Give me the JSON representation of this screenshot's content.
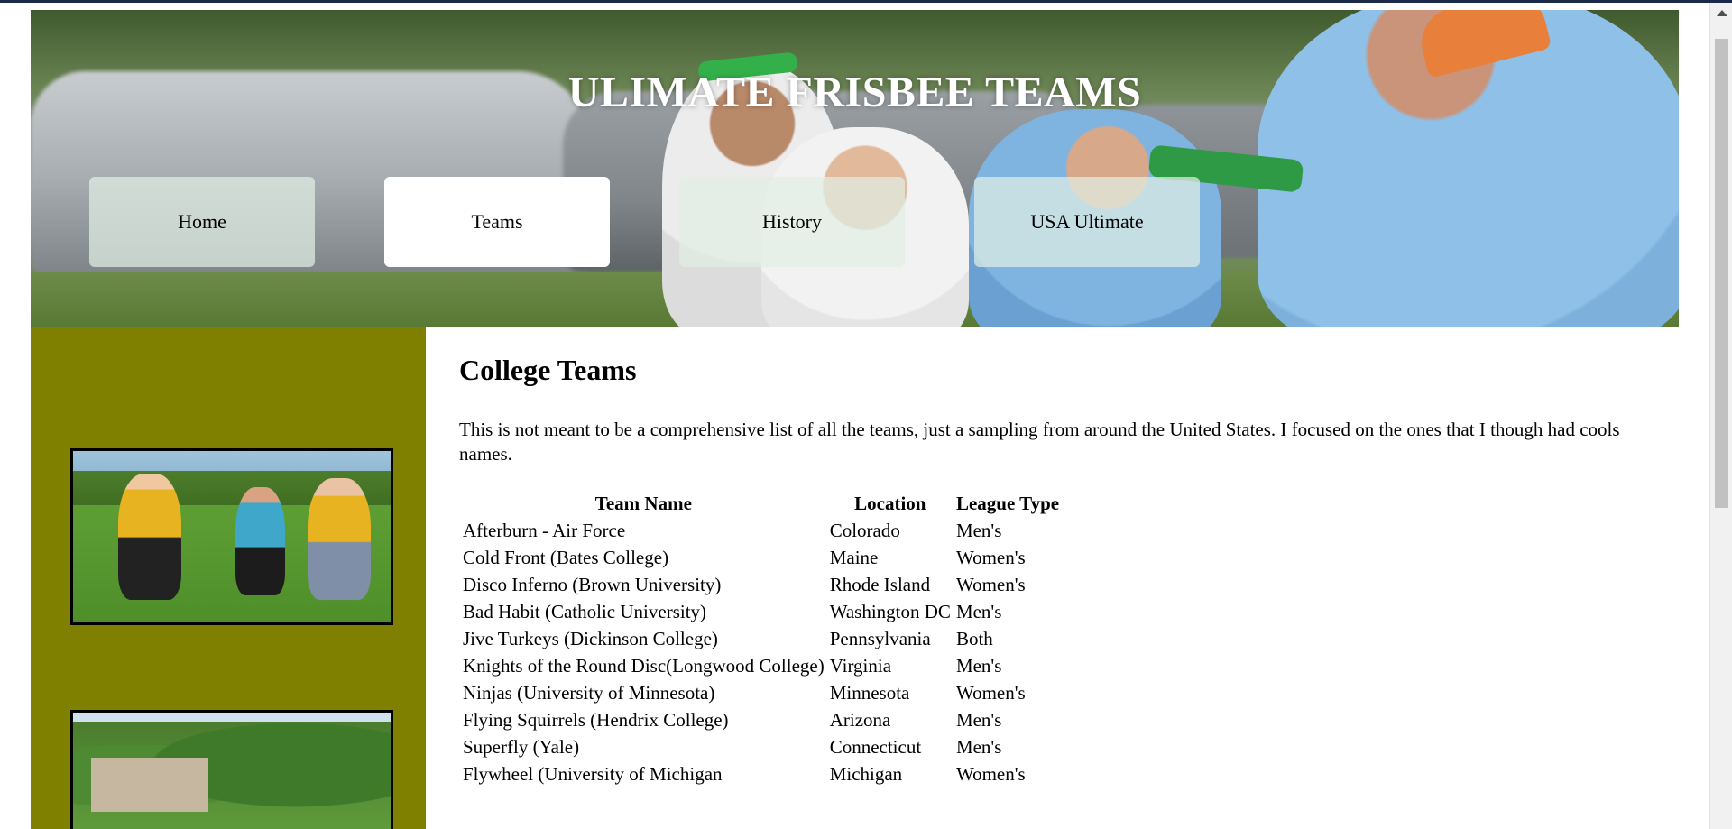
{
  "header": {
    "title": "ULIMATE FRISBEE TEAMS"
  },
  "nav": {
    "items": [
      {
        "label": "Home",
        "active": false
      },
      {
        "label": "Teams",
        "active": true
      },
      {
        "label": "History",
        "active": false
      },
      {
        "label": "USA Ultimate",
        "active": false
      }
    ]
  },
  "main": {
    "heading": "College Teams",
    "intro": "This is not meant to be a comprehensive list of all the teams, just a sampling from around the United States. I focused on the ones that I though had cools names.",
    "table": {
      "headers": [
        "Team Name",
        "Location",
        "League Type"
      ],
      "rows": [
        [
          "Afterburn - Air Force",
          "Colorado",
          "Men's"
        ],
        [
          "Cold Front (Bates College)",
          "Maine",
          "Women's"
        ],
        [
          "Disco Inferno (Brown University)",
          "Rhode Island",
          "Women's"
        ],
        [
          "Bad Habit (Catholic University)",
          "Washington DC",
          "Men's"
        ],
        [
          "Jive Turkeys (Dickinson College)",
          "Pennsylvania",
          "Both"
        ],
        [
          "Knights of the Round Disc(Longwood College)",
          "Virginia",
          "Men's"
        ],
        [
          "Ninjas (University of Minnesota)",
          "Minnesota",
          "Women's"
        ],
        [
          "Flying Squirrels (Hendrix College)",
          "Arizona",
          "Men's"
        ],
        [
          "Superfly (Yale)",
          "Connecticut",
          "Men's"
        ],
        [
          "Flywheel (University of Michigan",
          "Michigan",
          "Women's"
        ]
      ]
    }
  },
  "colors": {
    "sidebar": "#808000",
    "nav_button_active": "#ffffff",
    "title_text": "#ffffff"
  }
}
